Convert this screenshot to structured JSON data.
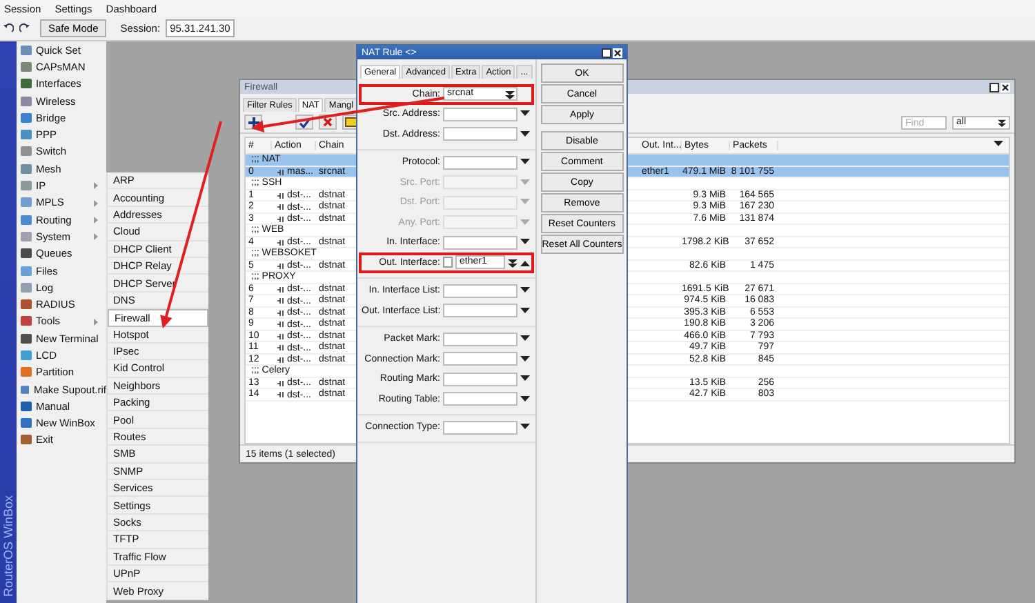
{
  "menu_bar": [
    "Session",
    "Settings",
    "Dashboard"
  ],
  "toolbar": {
    "safe_mode": "Safe Mode",
    "session_label": "Session:",
    "session_value": "95.31.241.30"
  },
  "side_label": "RouterOS WinBox",
  "sidebar": {
    "items": [
      {
        "label": "Quick Set",
        "submenu": false
      },
      {
        "label": "CAPsMAN",
        "submenu": false
      },
      {
        "label": "Interfaces",
        "submenu": false
      },
      {
        "label": "Wireless",
        "submenu": false
      },
      {
        "label": "Bridge",
        "submenu": false
      },
      {
        "label": "PPP",
        "submenu": false
      },
      {
        "label": "Switch",
        "submenu": false
      },
      {
        "label": "Mesh",
        "submenu": false
      },
      {
        "label": "IP",
        "submenu": true
      },
      {
        "label": "MPLS",
        "submenu": true
      },
      {
        "label": "Routing",
        "submenu": true
      },
      {
        "label": "System",
        "submenu": true
      },
      {
        "label": "Queues",
        "submenu": false
      },
      {
        "label": "Files",
        "submenu": false
      },
      {
        "label": "Log",
        "submenu": false
      },
      {
        "label": "RADIUS",
        "submenu": false
      },
      {
        "label": "Tools",
        "submenu": true
      },
      {
        "label": "New Terminal",
        "submenu": false
      },
      {
        "label": "LCD",
        "submenu": false
      },
      {
        "label": "Partition",
        "submenu": false
      },
      {
        "label": "Make Supout.rif",
        "submenu": false
      },
      {
        "label": "Manual",
        "submenu": false
      },
      {
        "label": "New WinBox",
        "submenu": false
      },
      {
        "label": "Exit",
        "submenu": false
      }
    ]
  },
  "submenu": {
    "items": [
      {
        "label": "ARP",
        "selected": false
      },
      {
        "label": "Accounting",
        "selected": false
      },
      {
        "label": "Addresses",
        "selected": false
      },
      {
        "label": "Cloud",
        "selected": false
      },
      {
        "label": "DHCP Client",
        "selected": false
      },
      {
        "label": "DHCP Relay",
        "selected": false
      },
      {
        "label": "DHCP Server",
        "selected": false
      },
      {
        "label": "DNS",
        "selected": false
      },
      {
        "label": "Firewall",
        "selected": true
      },
      {
        "label": "Hotspot",
        "selected": false
      },
      {
        "label": "IPsec",
        "selected": false
      },
      {
        "label": "Kid Control",
        "selected": false
      },
      {
        "label": "Neighbors",
        "selected": false
      },
      {
        "label": "Packing",
        "selected": false
      },
      {
        "label": "Pool",
        "selected": false
      },
      {
        "label": "Routes",
        "selected": false
      },
      {
        "label": "SMB",
        "selected": false
      },
      {
        "label": "SNMP",
        "selected": false
      },
      {
        "label": "Services",
        "selected": false
      },
      {
        "label": "Settings",
        "selected": false
      },
      {
        "label": "Socks",
        "selected": false
      },
      {
        "label": "TFTP",
        "selected": false
      },
      {
        "label": "Traffic Flow",
        "selected": false
      },
      {
        "label": "UPnP",
        "selected": false
      },
      {
        "label": "Web Proxy",
        "selected": false
      }
    ]
  },
  "firewall": {
    "title": "Firewall",
    "tabs": [
      {
        "label": "Filter Rules",
        "selected": false
      },
      {
        "label": "NAT",
        "selected": true
      },
      {
        "label": "Mangl",
        "selected": false
      }
    ],
    "find": {
      "placeholder": "Find"
    },
    "filter_value": "all",
    "columns": [
      "#",
      "Action",
      "Chain",
      "Out. Int...",
      "Bytes",
      "Packets"
    ],
    "rows": [
      {
        "kind": "comment",
        "text": ";;; NAT",
        "selected": true
      },
      {
        "kind": "rule",
        "number": "0",
        "action": "mas...",
        "chain": "srcnat",
        "out_interface": "ether1",
        "bytes": "479.1 MiB",
        "packets": "8 101 755",
        "selected": true
      },
      {
        "kind": "comment",
        "text": ";;; SSH",
        "selected": false
      },
      {
        "kind": "rule",
        "number": "1",
        "action": "dst-...",
        "chain": "dstnat",
        "bytes": "9.3 MiB",
        "packets": "164 565",
        "selected": false
      },
      {
        "kind": "rule",
        "number": "2",
        "action": "dst-...",
        "chain": "dstnat",
        "bytes": "9.3 MiB",
        "packets": "167 230",
        "selected": false
      },
      {
        "kind": "rule",
        "number": "3",
        "action": "dst-...",
        "chain": "dstnat",
        "bytes": "7.6 MiB",
        "packets": "131 874",
        "selected": false
      },
      {
        "kind": "comment",
        "text": ";;; WEB",
        "selected": false
      },
      {
        "kind": "rule",
        "number": "4",
        "action": "dst-...",
        "chain": "dstnat",
        "bytes": "1798.2 KiB",
        "packets": "37 652",
        "selected": false
      },
      {
        "kind": "comment",
        "text": ";;; WEBSOKET",
        "selected": false
      },
      {
        "kind": "rule",
        "number": "5",
        "action": "dst-...",
        "chain": "dstnat",
        "bytes": "82.6 KiB",
        "packets": "1 475",
        "selected": false
      },
      {
        "kind": "comment",
        "text": ";;; PROXY",
        "selected": false
      },
      {
        "kind": "rule",
        "number": "6",
        "action": "dst-...",
        "chain": "dstnat",
        "bytes": "1691.5 KiB",
        "packets": "27 671",
        "selected": false
      },
      {
        "kind": "rule",
        "number": "7",
        "action": "dst-...",
        "chain": "dstnat",
        "bytes": "974.5 KiB",
        "packets": "16 083",
        "selected": false
      },
      {
        "kind": "rule",
        "number": "8",
        "action": "dst-...",
        "chain": "dstnat",
        "bytes": "395.3 KiB",
        "packets": "6 553",
        "selected": false
      },
      {
        "kind": "rule",
        "number": "9",
        "action": "dst-...",
        "chain": "dstnat",
        "bytes": "190.8 KiB",
        "packets": "3 206",
        "selected": false
      },
      {
        "kind": "rule",
        "number": "10",
        "action": "dst-...",
        "chain": "dstnat",
        "bytes": "466.0 KiB",
        "packets": "7 793",
        "selected": false
      },
      {
        "kind": "rule",
        "number": "11",
        "action": "dst-...",
        "chain": "dstnat",
        "bytes": "49.7 KiB",
        "packets": "797",
        "selected": false
      },
      {
        "kind": "rule",
        "number": "12",
        "action": "dst-...",
        "chain": "dstnat",
        "bytes": "52.8 KiB",
        "packets": "845",
        "selected": false
      },
      {
        "kind": "comment",
        "text": ";;; Celery",
        "selected": false
      },
      {
        "kind": "rule",
        "number": "13",
        "action": "dst-...",
        "chain": "dstnat",
        "bytes": "13.5 KiB",
        "packets": "256",
        "selected": false
      },
      {
        "kind": "rule",
        "number": "14",
        "action": "dst-...",
        "chain": "dstnat",
        "bytes": "42.7 KiB",
        "packets": "803",
        "selected": false
      }
    ],
    "status": "15 items (1 selected)"
  },
  "nat_rule": {
    "title": "NAT Rule <>",
    "tabs": [
      {
        "label": "General",
        "selected": true
      },
      {
        "label": "Advanced",
        "selected": false
      },
      {
        "label": "Extra",
        "selected": false
      },
      {
        "label": "Action",
        "selected": false
      },
      {
        "label": "...",
        "selected": false
      }
    ],
    "groups": [
      [
        {
          "kind": "combo",
          "label": "Chain:",
          "value": "srcnat",
          "highlighted": true,
          "disabled": false
        },
        {
          "kind": "select",
          "label": "Src. Address:",
          "highlighted": false,
          "disabled": false
        },
        {
          "kind": "select",
          "label": "Dst. Address:",
          "highlighted": false,
          "disabled": false
        }
      ],
      [
        {
          "kind": "select",
          "label": "Protocol:",
          "highlighted": false,
          "disabled": false
        },
        {
          "kind": "select",
          "label": "Src. Port:",
          "highlighted": false,
          "disabled": true
        },
        {
          "kind": "select",
          "label": "Dst. Port:",
          "highlighted": false,
          "disabled": true
        },
        {
          "kind": "select",
          "label": "Any. Port:",
          "highlighted": false,
          "disabled": true
        },
        {
          "kind": "select",
          "label": "In. Interface:",
          "highlighted": false,
          "disabled": false
        },
        {
          "kind": "invert",
          "label": "Out. Interface:",
          "value": "ether1",
          "checked": false,
          "highlighted": true,
          "disabled": false
        }
      ],
      [
        {
          "kind": "select",
          "label": "In. Interface List:",
          "highlighted": false,
          "disabled": false
        },
        {
          "kind": "select",
          "label": "Out. Interface List:",
          "highlighted": false,
          "disabled": false
        }
      ],
      [
        {
          "kind": "select",
          "label": "Packet Mark:",
          "highlighted": false,
          "disabled": false
        },
        {
          "kind": "select",
          "label": "Connection Mark:",
          "highlighted": false,
          "disabled": false
        },
        {
          "kind": "select",
          "label": "Routing Mark:",
          "highlighted": false,
          "disabled": false
        },
        {
          "kind": "select",
          "label": "Routing Table:",
          "highlighted": false,
          "disabled": false
        }
      ],
      [
        {
          "kind": "select",
          "label": "Connection Type:",
          "highlighted": false,
          "disabled": false
        }
      ]
    ],
    "buttons": [
      [
        "OK",
        "Cancel",
        "Apply"
      ],
      [
        "Disable",
        "Comment",
        "Copy",
        "Remove",
        "Reset Counters",
        "Reset All Counters"
      ]
    ]
  }
}
